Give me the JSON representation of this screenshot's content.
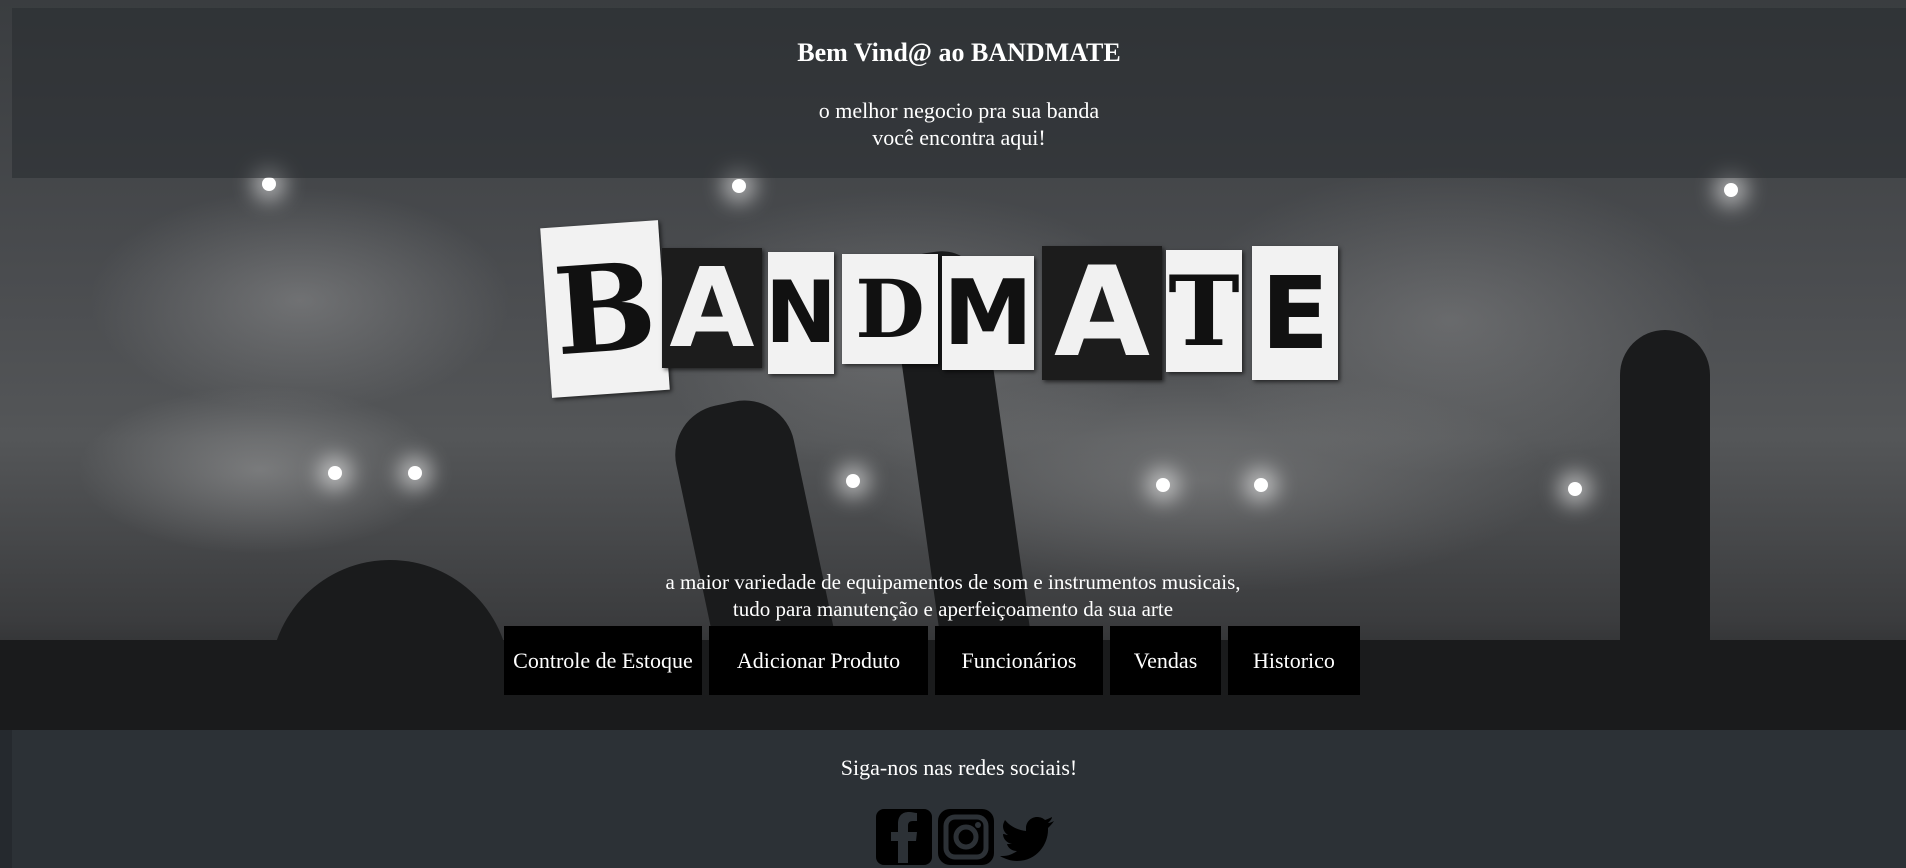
{
  "header": {
    "title": "Bem Vind@ ao BANDMATE",
    "tagline_line1": "o melhor negocio pra sua banda",
    "tagline_line2": "você encontra aqui!"
  },
  "logo": {
    "text": "BANDMATE",
    "letters": [
      "B",
      "A",
      "N",
      "D",
      "M",
      "A",
      "T",
      "E"
    ]
  },
  "description": {
    "line1": "a maior variedade de equipamentos de som e instrumentos musicais,",
    "line2": "tudo para manutenção e aperfeiçoamento da sua arte"
  },
  "nav": {
    "items": [
      {
        "label": "Controle de Estoque"
      },
      {
        "label": "Adicionar Produto"
      },
      {
        "label": "Funcionários"
      },
      {
        "label": "Vendas"
      },
      {
        "label": "Historico"
      }
    ]
  },
  "footer": {
    "follow_text": "Siga-nos nas redes sociais!",
    "social_icons": [
      "facebook-icon",
      "instagram-icon",
      "twitter-icon"
    ]
  },
  "colors": {
    "header_band": "#2c3136",
    "button_bg": "#000000",
    "text": "#ffffff"
  }
}
